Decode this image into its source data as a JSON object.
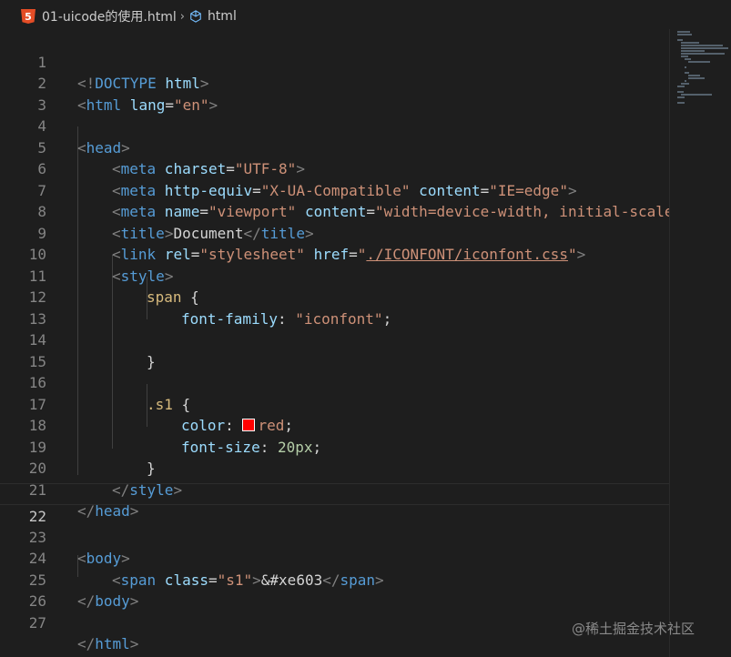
{
  "breadcrumb": {
    "file_icon": "html5-icon",
    "file_icon_text": "5",
    "file_name": "01-uicode的使用.html",
    "separator": "›",
    "symbol_icon": "cube-icon",
    "symbol_name": "html"
  },
  "editor": {
    "active_line": 22,
    "line_numbers": [
      "1",
      "2",
      "3",
      "4",
      "5",
      "6",
      "7",
      "8",
      "9",
      "10",
      "11",
      "12",
      "13",
      "14",
      "15",
      "16",
      "17",
      "18",
      "19",
      "20",
      "21",
      "22",
      "23",
      "24",
      "25",
      "26",
      "27"
    ]
  },
  "code": {
    "l1": {
      "a": "<!",
      "b": "DOCTYPE",
      "c": " html",
      "d": ">"
    },
    "l2": {
      "a": "<",
      "b": "html",
      "c": " lang",
      "d": "=",
      "e": "\"en\"",
      "f": ">"
    },
    "l4": {
      "a": "<",
      "b": "head",
      "c": ">"
    },
    "l5": {
      "a": "<",
      "b": "meta",
      "c": " charset",
      "d": "=",
      "e": "\"UTF-8\"",
      "f": ">"
    },
    "l6": {
      "a": "<",
      "b": "meta",
      "c": " http-equiv",
      "d": "=",
      "e": "\"X-UA-Compatible\"",
      "f": " content",
      "g": "=",
      "h": "\"IE=edge\"",
      "i": ">"
    },
    "l7": {
      "a": "<",
      "b": "meta",
      "c": " name",
      "d": "=",
      "e": "\"viewport\"",
      "f": " content",
      "g": "=",
      "h": "\"width=device-width, initial-scale"
    },
    "l8": {
      "a": "<",
      "b": "title",
      "c": ">",
      "d": "Document",
      "e": "</",
      "f": "title",
      "g": ">"
    },
    "l9": {
      "a": "<",
      "b": "link",
      "c": " rel",
      "d": "=",
      "e": "\"stylesheet\"",
      "f": " href",
      "g": "=",
      "h": "\"",
      "i": "./ICONFONT/iconfont.css",
      "j": "\"",
      "k": ">"
    },
    "l10": {
      "a": "<",
      "b": "style",
      "c": ">"
    },
    "l11": {
      "a": "span",
      "b": " {"
    },
    "l12": {
      "a": "font-family",
      "b": ": ",
      "c": "\"iconfont\"",
      "d": ";"
    },
    "l14": {
      "a": "}"
    },
    "l16": {
      "a": ".s1",
      "b": " {"
    },
    "l17": {
      "a": "color",
      "b": ": ",
      "c": "red",
      "d": ";"
    },
    "l18": {
      "a": "font-size",
      "b": ": ",
      "c": "20px",
      "d": ";"
    },
    "l19": {
      "a": "}"
    },
    "l20": {
      "a": "</",
      "b": "style",
      "c": ">"
    },
    "l21": {
      "a": "</",
      "b": "head",
      "c": ">"
    },
    "l23": {
      "a": "<",
      "b": "body",
      "c": ">"
    },
    "l24": {
      "a": "<",
      "b": "span",
      "c": " class",
      "d": "=",
      "e": "\"s1\"",
      "f": ">",
      "g": "&#xe603",
      "h": "</",
      "i": "span",
      "j": ">"
    },
    "l25": {
      "a": "</",
      "b": "body",
      "c": ">"
    },
    "l27": {
      "a": "</",
      "b": "html",
      "c": ">"
    }
  },
  "colors": {
    "background": "#1e1e1e",
    "tag": "#569cd6",
    "attribute": "#9cdcfe",
    "string": "#ce9178",
    "selector": "#d7ba7d",
    "number": "#b5cea8",
    "swatch_red": "#ff0000"
  },
  "watermark": "@稀土掘金技术社区"
}
